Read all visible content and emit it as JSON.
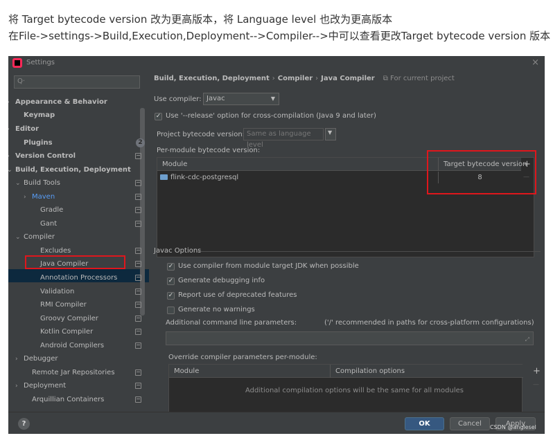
{
  "caption": {
    "line1": "将 Target bytecode version 改为更高版本，将 Language level 也改为更高版本",
    "line2": "在File->settings->Build,Execution,Deployment-->Compiler-->中可以查看更改Target bytecode version 版本"
  },
  "window": {
    "title": "Settings",
    "close_glyph": "×"
  },
  "sidebar": {
    "search_glyph": "Q·",
    "items": [
      {
        "label": "Appearance & Behavior",
        "arrow": "›"
      },
      {
        "label": "Keymap",
        "arrow": ""
      },
      {
        "label": "Editor",
        "arrow": "›"
      },
      {
        "label": "Plugins",
        "arrow": "",
        "badge": "2"
      },
      {
        "label": "Version Control",
        "arrow": "›"
      },
      {
        "label": "Build, Execution, Deployment",
        "arrow": "⌄"
      },
      {
        "label": "Build Tools",
        "arrow": "⌄"
      },
      {
        "label": "Maven",
        "arrow": "›"
      },
      {
        "label": "Gradle",
        "arrow": ""
      },
      {
        "label": "Gant",
        "arrow": ""
      },
      {
        "label": "Compiler",
        "arrow": "⌄"
      },
      {
        "label": "Excludes",
        "arrow": ""
      },
      {
        "label": "Java Compiler",
        "arrow": ""
      },
      {
        "label": "Annotation Processors",
        "arrow": ""
      },
      {
        "label": "Validation",
        "arrow": ""
      },
      {
        "label": "RMI Compiler",
        "arrow": ""
      },
      {
        "label": "Groovy Compiler",
        "arrow": ""
      },
      {
        "label": "Kotlin Compiler",
        "arrow": ""
      },
      {
        "label": "Android Compilers",
        "arrow": ""
      },
      {
        "label": "Debugger",
        "arrow": "›"
      },
      {
        "label": "Remote Jar Repositories",
        "arrow": ""
      },
      {
        "label": "Deployment",
        "arrow": "›"
      },
      {
        "label": "Arquillian Containers",
        "arrow": ""
      }
    ]
  },
  "breadcrumb": {
    "part1": "Build, Execution, Deployment",
    "sep": "›",
    "part2": "Compiler",
    "part3": "Java Compiler",
    "project_scope": "⧉ For current project"
  },
  "compiler": {
    "use_compiler_label": "Use compiler:",
    "use_compiler_value": "Javac",
    "caret": "▼",
    "release_option_label": "Use '--release' option for cross-compilation (Java 9 and later)",
    "release_option_checked": true,
    "project_bytecode_label": "Project bytecode version:",
    "project_bytecode_placeholder": "Same as language level",
    "per_module_label": "Per-module bytecode version:"
  },
  "module_table": {
    "col_module": "Module",
    "col_target": "Target bytecode version",
    "add_glyph": "+",
    "remove_glyph": "—",
    "rows": [
      {
        "module": "flink-cdc-postgresql",
        "target": "8"
      }
    ]
  },
  "javac_options": {
    "section_title": "Javac Options",
    "checkbox_checked_glyph": "✓",
    "options": [
      {
        "label": "Use compiler from module target JDK when possible",
        "checked": true
      },
      {
        "label": "Generate debugging info",
        "checked": true
      },
      {
        "label": "Report use of deprecated features",
        "checked": true
      },
      {
        "label": "Generate no warnings",
        "checked": false
      }
    ],
    "additional_params_label": "Additional command line parameters:",
    "additional_params_hint": "('/' recommended in paths for cross-platform configurations)",
    "expand_glyph": "⤢"
  },
  "override": {
    "label": "Override compiler parameters per-module:",
    "col_module": "Module",
    "col_options": "Compilation options",
    "empty_text": "Additional compilation options will be the same for all modules",
    "add_glyph": "+",
    "remove_glyph": "—"
  },
  "footer": {
    "help_glyph": "?",
    "ok": "OK",
    "cancel": "Cancel",
    "apply": "Apply"
  },
  "watermark": "CSDN @anglesel",
  "colors": {
    "highlight_red": "#e0161c",
    "selection": "#0d293e",
    "link_blue": "#589df6",
    "primary_button": "#365880"
  }
}
